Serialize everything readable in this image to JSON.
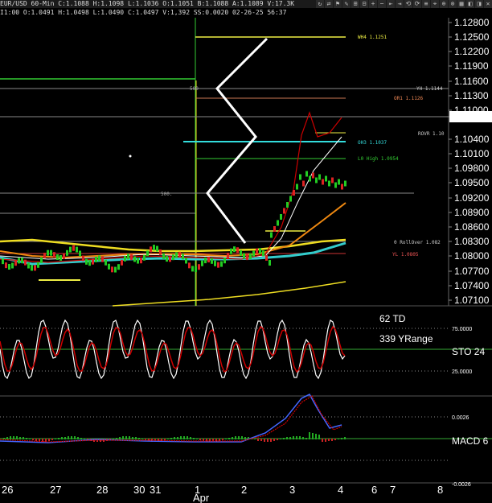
{
  "toolbar": {
    "symbol_text": "EUR/USD  60-Min  C:1.1088  H:1.1098  L:1.1036  O:1.1051  B:1.1088  A:1.1089  V:17.3K",
    "icons": [
      "↻",
      "⇄",
      "⚑",
      "✎",
      "⊞",
      "⊟",
      "+",
      "−",
      "⇤",
      "⇥",
      "⟲",
      "⟳",
      "≡",
      "⌖",
      "⊕",
      "⊗",
      "▦",
      "◧",
      "◨",
      "✕"
    ]
  },
  "header": {
    "ohlc_text": "I1:00  O:1.0491  H:1.0498  L:1.0490  C:1.0497  V:1,392  SS:0.0020  02-26-25  56:37"
  },
  "price_axis": {
    "labels": [
      "1.12800",
      "1.12500",
      "1.12200",
      "1.11900",
      "1.11600",
      "1.11300",
      "1.11000",
      "1.10400",
      "1.10100",
      "1.09800",
      "1.09500",
      "1.09200",
      "1.08900",
      "1.08600",
      "1.08300",
      "1.08000",
      "1.07700",
      "1.07400",
      "1.07100"
    ],
    "current_price": "1.10880"
  },
  "levels": {
    "wh4": "WH4  1.1251",
    "yh": "YH 1.1144",
    "or1": "OR1 1.1126",
    "rovr": "ROVR 1.10",
    "oh3": "OH3 1.1037",
    "lo_high": "L0 High 1.0954",
    "rollover": "0 RollOver 1.082",
    "yl": "YL 1.0805",
    "fib_top": "500",
    "fib_mid": "500."
  },
  "stochastic": {
    "td_text": "62 TD",
    "yrange_text": "339 YRange",
    "label": "STO  24",
    "tick_75": "75.0000",
    "tick_25": "25.0000"
  },
  "macd": {
    "label": "MACD 6",
    "tick_pos": "0.0026",
    "tick_neg": "-0.0026"
  },
  "time_axis": {
    "labels": [
      "26",
      "27",
      "28",
      "30",
      "31",
      "1",
      "2",
      "3",
      "4",
      "6",
      "7",
      "8"
    ],
    "month": "Apr"
  },
  "colors": {
    "candle_up": "#22cc22",
    "candle_down": "#dd2222",
    "fast_ma": "#cc0000",
    "slow_ma": "#ffffff",
    "ma_yellow": "#eedd22",
    "ma_orange": "#ee8811",
    "ma_cyan": "#33cccc",
    "level_cyan": "#33dddd",
    "level_yellow": "#eeee44",
    "level_green": "#33cc33",
    "level_red": "#cc3333",
    "zigzag": "#ffffff"
  }
}
